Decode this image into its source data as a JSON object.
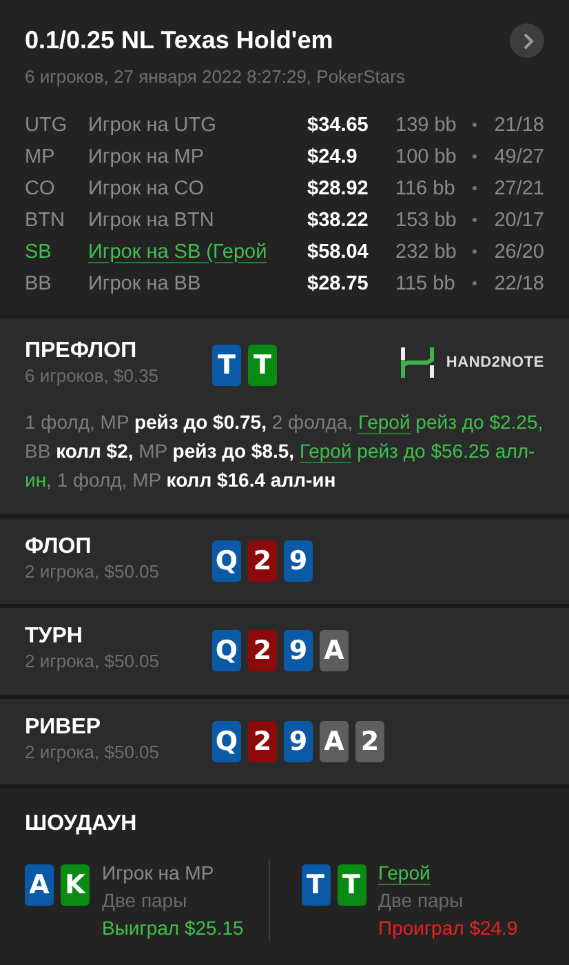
{
  "header": {
    "title": "0.1/0.25 NL Texas Hold'em",
    "subtitle": "6 игроков, 27 января 2022 8:27:29, PokerStars"
  },
  "players": [
    {
      "position": "UTG",
      "name": "Игрок на UTG",
      "stack": "$34.65",
      "bb": "139 bb",
      "stats": "21/18",
      "hero": false
    },
    {
      "position": "MP",
      "name": "Игрок на MP",
      "stack": "$24.9",
      "bb": "100 bb",
      "stats": "49/27",
      "hero": false
    },
    {
      "position": "CO",
      "name": "Игрок на CO",
      "stack": "$28.92",
      "bb": "116 bb",
      "stats": "27/21",
      "hero": false
    },
    {
      "position": "BTN",
      "name": "Игрок на BTN",
      "stack": "$38.22",
      "bb": "153 bb",
      "stats": "20/17",
      "hero": false
    },
    {
      "position": "SB",
      "name": "Игрок на SB (Герой",
      "stack": "$58.04",
      "bb": "232 bb",
      "stats": "26/20",
      "hero": true
    },
    {
      "position": "BB",
      "name": "Игрок на BB",
      "stack": "$28.75",
      "bb": "115 bb",
      "stats": "22/18",
      "hero": false
    }
  ],
  "streets": [
    {
      "title": "ПРЕФЛОП",
      "info": "6 игроков, $0.35",
      "cards": [
        {
          "rank": "T",
          "color": "#0a5aa8"
        },
        {
          "rank": "T",
          "color": "#0a8a12"
        }
      ],
      "logo": "HAND2NOTE",
      "actions": [
        {
          "kind": "muted",
          "text": "1 фолд, MP "
        },
        {
          "kind": "action",
          "text": "рейз до $0.75, "
        },
        {
          "kind": "muted",
          "text": "2 фолда, "
        },
        {
          "kind": "hero-name",
          "text": "Герой"
        },
        {
          "kind": "hero",
          "text": " рейз до $2.25, "
        },
        {
          "kind": "muted",
          "text": "BB "
        },
        {
          "kind": "action",
          "text": "колл $2, "
        },
        {
          "kind": "muted",
          "text": "MP "
        },
        {
          "kind": "action",
          "text": "рейз до $8.5, "
        },
        {
          "kind": "hero-name",
          "text": "Герой"
        },
        {
          "kind": "hero",
          "text": " рейз до $56.25 алл-ин, "
        },
        {
          "kind": "muted",
          "text": "1 фолд, MP "
        },
        {
          "kind": "action",
          "text": "колл $16.4 алл-ин"
        }
      ]
    },
    {
      "title": "ФЛОП",
      "info": "2 игрока, $50.05",
      "cards": [
        {
          "rank": "Q",
          "color": "#0a5aa8"
        },
        {
          "rank": "2",
          "color": "#8e0a0a"
        },
        {
          "rank": "9",
          "color": "#0a5aa8"
        }
      ]
    },
    {
      "title": "ТУРН",
      "info": "2 игрока, $50.05",
      "cards": [
        {
          "rank": "Q",
          "color": "#0a5aa8"
        },
        {
          "rank": "2",
          "color": "#8e0a0a"
        },
        {
          "rank": "9",
          "color": "#0a5aa8"
        },
        {
          "rank": "A",
          "color": "#5e5e5e"
        }
      ]
    },
    {
      "title": "РИВЕР",
      "info": "2 игрока, $50.05",
      "cards": [
        {
          "rank": "Q",
          "color": "#0a5aa8"
        },
        {
          "rank": "2",
          "color": "#8e0a0a"
        },
        {
          "rank": "9",
          "color": "#0a5aa8"
        },
        {
          "rank": "A",
          "color": "#5e5e5e"
        },
        {
          "rank": "2",
          "color": "#5e5e5e"
        }
      ]
    }
  ],
  "showdown": {
    "title": "ШОУДАУН",
    "hands": [
      {
        "name": "Игрок на MP",
        "hero": false,
        "combo": "Две пары",
        "result": "Выиграл $25.15",
        "won": true,
        "cards": [
          {
            "rank": "A",
            "color": "#0a5aa8"
          },
          {
            "rank": "K",
            "color": "#0a8a12"
          }
        ]
      },
      {
        "name": "Герой",
        "hero": true,
        "combo": "Две пары",
        "result": "Проиграл $24.9",
        "won": false,
        "cards": [
          {
            "rank": "T",
            "color": "#0a5aa8"
          },
          {
            "rank": "T",
            "color": "#0a8a12"
          }
        ]
      }
    ]
  }
}
